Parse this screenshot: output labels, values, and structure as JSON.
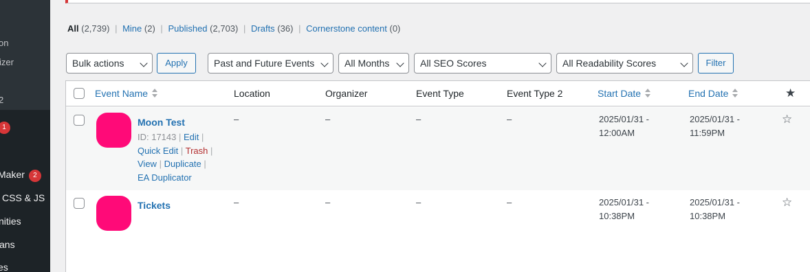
{
  "sidebar": {
    "items": [
      {
        "label": "on"
      },
      {
        "label": "izer"
      },
      {
        "label": "2"
      },
      {
        "label": "1"
      },
      {
        "label": "Maker",
        "badge": "2"
      },
      {
        "label": "CSS & JS"
      },
      {
        "label": "nities"
      },
      {
        "label": "ans"
      },
      {
        "label": "es"
      }
    ]
  },
  "views": {
    "all": {
      "label": "All",
      "count": "(2,739)"
    },
    "mine": {
      "label": "Mine",
      "count": "(2)"
    },
    "published": {
      "label": "Published",
      "count": "(2,703)"
    },
    "drafts": {
      "label": "Drafts",
      "count": "(36)"
    },
    "cornerstone": {
      "label": "Cornerstone content",
      "count": "(0)"
    }
  },
  "filters": {
    "bulk_actions": "Bulk actions",
    "apply": "Apply",
    "event_scope": "Past and Future Events",
    "months": "All Months",
    "seo": "All SEO Scores",
    "readability": "All Readability Scores",
    "filter": "Filter"
  },
  "columns": {
    "event_name": "Event Name",
    "location": "Location",
    "organizer": "Organizer",
    "event_type": "Event Type",
    "event_type_2": "Event Type 2",
    "start_date": "Start Date",
    "end_date": "End Date",
    "featured_icon": "star-icon"
  },
  "rows": [
    {
      "title": "Moon Test",
      "id_label": "ID: 17143",
      "actions": {
        "edit": "Edit",
        "quick_edit": "Quick Edit",
        "trash": "Trash",
        "view": "View",
        "duplicate": "Duplicate",
        "ea_duplicator": "EA Duplicator"
      },
      "location": "–",
      "organizer": "–",
      "event_type": "–",
      "event_type_2": "–",
      "start_date": "2025/01/31 -",
      "start_time": "12:00AM",
      "end_date": "2025/01/31 -",
      "end_time": "11:59PM",
      "thumb_color": "#ff0a78"
    },
    {
      "title": "Tickets",
      "location": "–",
      "organizer": "–",
      "event_type": "–",
      "event_type_2": "–",
      "start_date": "2025/01/31 -",
      "start_time": "10:38PM",
      "end_date": "2025/01/31 -",
      "end_time": "10:38PM",
      "thumb_color": "#ff0a78"
    }
  ],
  "colors": {
    "link": "#2271b1",
    "trash": "#b32d2e",
    "badge": "#d63638",
    "sidebar": "#1d2327"
  }
}
